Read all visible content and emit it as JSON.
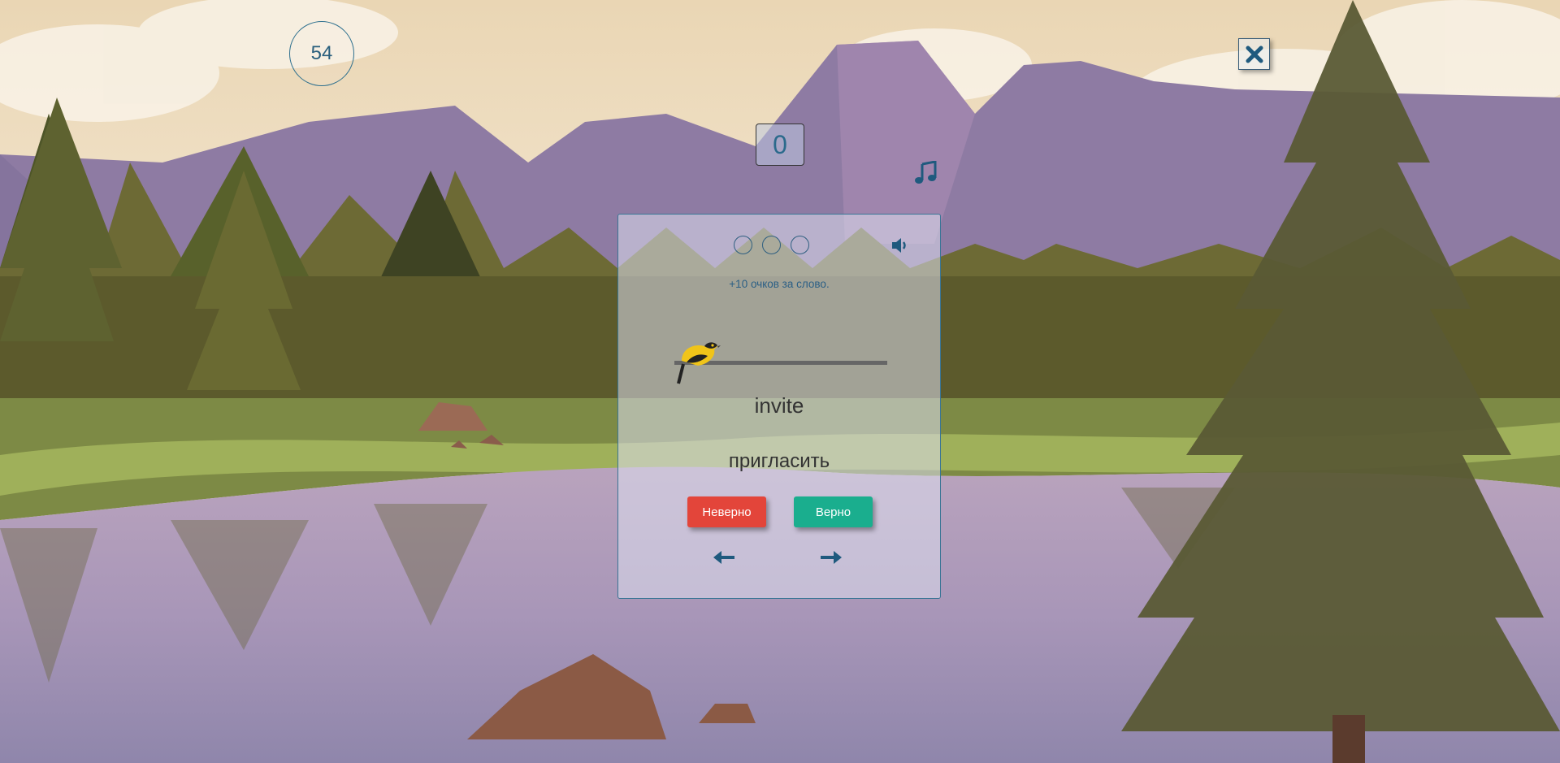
{
  "game": {
    "timer": "54",
    "score": "0",
    "hearts_count": 3,
    "points_hint": "+10 очков за слово.",
    "word": "invite",
    "translation": "пригласить",
    "wrong_label": "Неверно",
    "right_label": "Верно"
  },
  "icons": {
    "close": "close-icon",
    "music": "music-note-icon",
    "speaker": "speaker-icon",
    "prev": "arrow-left-icon",
    "next": "arrow-right-icon",
    "bird": "bird-icon"
  },
  "colors": {
    "accent": "#1f5a7e",
    "wrong": "#e3453a",
    "right": "#1aae8e"
  }
}
